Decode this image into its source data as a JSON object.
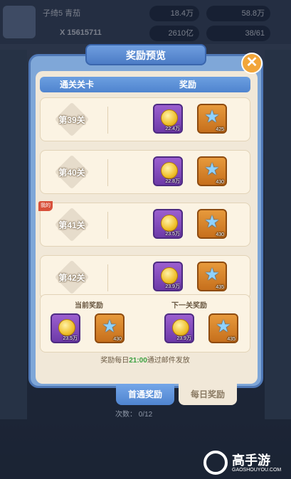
{
  "header": {
    "player_name": "子绮5 青茄",
    "player_id": "X 15615711",
    "resources": [
      "18.4万",
      "58.8万",
      "2610亿",
      "38/61"
    ]
  },
  "dialog": {
    "title": "奖励预览",
    "col_stage": "通关关卡",
    "col_reward": "奖励",
    "rows": [
      {
        "stage": "第39关",
        "gold": "22.4万",
        "star": "425",
        "mine": ""
      },
      {
        "stage": "第40关",
        "gold": "22.8万",
        "star": "430",
        "mine": ""
      },
      {
        "stage": "第41关",
        "gold": "23.5万",
        "star": "430",
        "mine": "我的"
      },
      {
        "stage": "第42关",
        "gold": "23.9万",
        "star": "435",
        "mine": ""
      }
    ],
    "summary": {
      "current_label": "当前奖励",
      "next_label": "下一关奖励",
      "current": {
        "gold": "23.5万",
        "star": "430"
      },
      "next": {
        "gold": "23.9万",
        "star": "435"
      }
    },
    "note_prefix": "奖励每日",
    "note_time": "21:00",
    "note_suffix": "通过邮件发放",
    "tabs": [
      "首通奖励",
      "每日奖励"
    ]
  },
  "bottom_note": "次数： 0/12",
  "brand": {
    "name": "高手游",
    "url": "GAOSHOUYOU.COM"
  },
  "colors": {
    "accent_blue": "#4f84cf",
    "panel_cream": "#f1e8d8",
    "close_orange": "#f2a63a",
    "time_green": "#3aa040"
  }
}
